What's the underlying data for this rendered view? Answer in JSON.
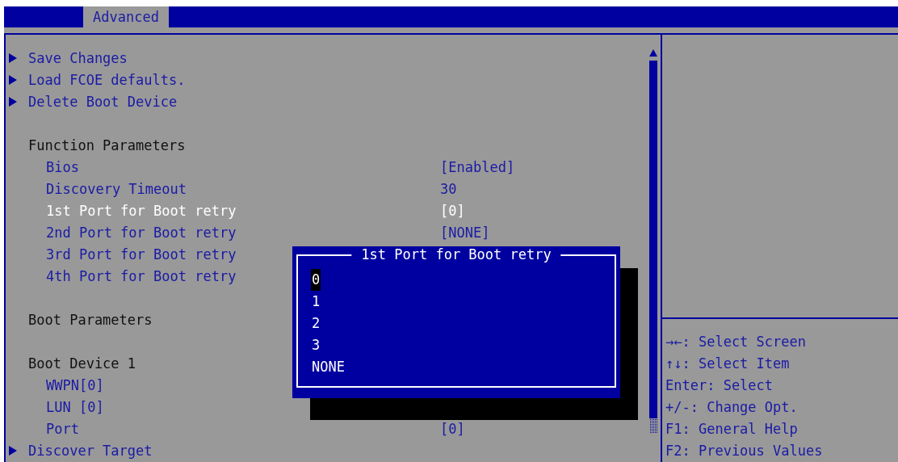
{
  "tabs": [
    {
      "label": "Advanced",
      "selected": true
    }
  ],
  "menu": {
    "items": [
      {
        "kind": "submenu",
        "label": "Save Changes",
        "selected": false
      },
      {
        "kind": "submenu",
        "label": "Load FCOE defaults.",
        "selected": false
      },
      {
        "kind": "submenu",
        "label": "Delete Boot Device",
        "selected": false
      },
      {
        "kind": "header",
        "label": "Function Parameters"
      },
      {
        "kind": "setting",
        "label": "Bios",
        "value": "[Enabled]",
        "selected": false
      },
      {
        "kind": "setting",
        "label": "Discovery Timeout",
        "value": "30",
        "selected": false
      },
      {
        "kind": "setting",
        "label": "1st Port for Boot retry",
        "value": "[0]",
        "selected": true
      },
      {
        "kind": "setting",
        "label": "2nd Port for Boot retry",
        "value": "[NONE]",
        "selected": false
      },
      {
        "kind": "setting",
        "label": "3rd Port for Boot retry",
        "selected": false
      },
      {
        "kind": "setting",
        "label": "4th Port for Boot retry",
        "selected": false
      },
      {
        "kind": "header",
        "label": "Boot Parameters"
      },
      {
        "kind": "header",
        "label": "Boot Device 1"
      },
      {
        "kind": "setting",
        "label": "WWPN[0]",
        "selected": false
      },
      {
        "kind": "setting",
        "label": "LUN [0]",
        "selected": false
      },
      {
        "kind": "setting",
        "label": "Port",
        "value": "[0]",
        "selected": false
      },
      {
        "kind": "submenu",
        "label": "Discover Target",
        "selected": false
      }
    ]
  },
  "dialog": {
    "title": "1st Port for Boot retry",
    "options": [
      {
        "label": "0",
        "selected": true
      },
      {
        "label": "1",
        "selected": false
      },
      {
        "label": "2",
        "selected": false
      },
      {
        "label": "3",
        "selected": false
      },
      {
        "label": "NONE",
        "selected": false
      }
    ]
  },
  "help": [
    "→←: Select Screen",
    "↑↓: Select Item",
    "Enter: Select",
    "+/-: Change Opt.",
    "F1: General Help",
    "F2: Previous Values"
  ]
}
